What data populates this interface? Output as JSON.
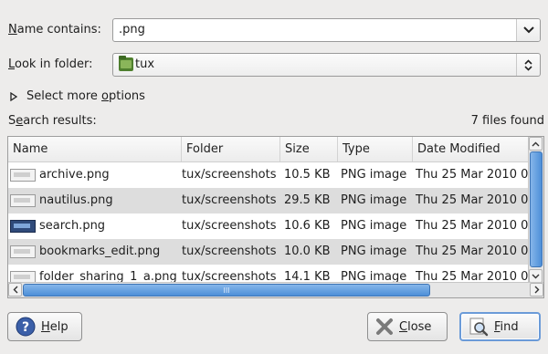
{
  "name_row": {
    "label_prefix": "N",
    "label_rest": "ame contains:",
    "value": ".png"
  },
  "folder_row": {
    "label_prefix": "L",
    "label_rest": "ook in folder:",
    "value": "tux"
  },
  "more_options": {
    "label_main": "Select more ",
    "label_u": "o",
    "label_end": "ptions"
  },
  "results": {
    "label_start": "S",
    "label_u": "e",
    "label_end": "arch results:",
    "count": "7 files found"
  },
  "table": {
    "columns": [
      "Name",
      "Folder",
      "Size",
      "Type",
      "Date Modified"
    ],
    "rows": [
      {
        "name": "archive.png",
        "folder": "tux/screenshots",
        "size": "10.5 KB",
        "type": "PNG image",
        "date": "Thu 25 Mar 2010 0",
        "icon": "doc-thumb-icon"
      },
      {
        "name": "nautilus.png",
        "folder": "tux/screenshots",
        "size": "29.5 KB",
        "type": "PNG image",
        "date": "Thu 25 Mar 2010 0",
        "icon": "doc-thumb-icon"
      },
      {
        "name": "search.png",
        "folder": "tux/screenshots",
        "size": "10.6 KB",
        "type": "PNG image",
        "date": "Thu 25 Mar 2010 0",
        "icon": "screenshot-thumb-icon"
      },
      {
        "name": "bookmarks_edit.png",
        "folder": "tux/screenshots",
        "size": "10.0 KB",
        "type": "PNG image",
        "date": "Thu 25 Mar 2010 0",
        "icon": "doc-thumb-icon"
      },
      {
        "name": "folder_sharing_1_a.png",
        "folder": "tux/screenshots",
        "size": "14.1 KB",
        "type": "PNG image",
        "date": "Thu 25 Mar 2010 0",
        "icon": "doc-thumb-icon"
      }
    ],
    "hscroll_grip": "III"
  },
  "buttons": {
    "help_u": "H",
    "help_rest": "elp",
    "close_u": "C",
    "close_rest": "lose",
    "find_u": "F",
    "find_rest": "ind"
  },
  "colors": {
    "selection": "#4d8fd8",
    "row_alt": "#dddddd",
    "background": "#edeceb"
  }
}
